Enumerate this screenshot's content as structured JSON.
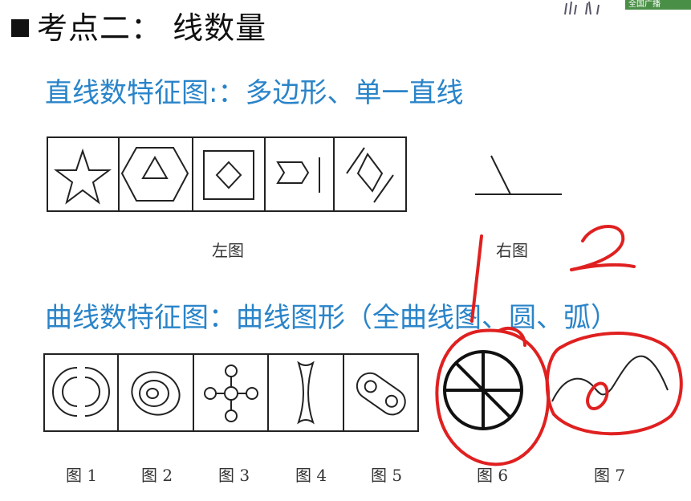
{
  "heading": {
    "bullet": "■",
    "text": "考点二：  线数量"
  },
  "badge": {
    "text": "全国广播"
  },
  "section1": {
    "title": "直线数特征图:：多边形、单一直线",
    "left_caption": "左图",
    "right_caption": "右图"
  },
  "section2": {
    "title": "曲线数特征图：曲线图形（全曲线图、圆、弧）",
    "captions": [
      "图 1",
      "图 2",
      "图 3",
      "图 4",
      "图 5",
      "图 6",
      "图 7"
    ]
  },
  "annotations": {
    "mark_1": "1",
    "mark_2": "2"
  },
  "colors": {
    "heading_blue": "#2a84c9",
    "annotation_red": "#e02020"
  }
}
